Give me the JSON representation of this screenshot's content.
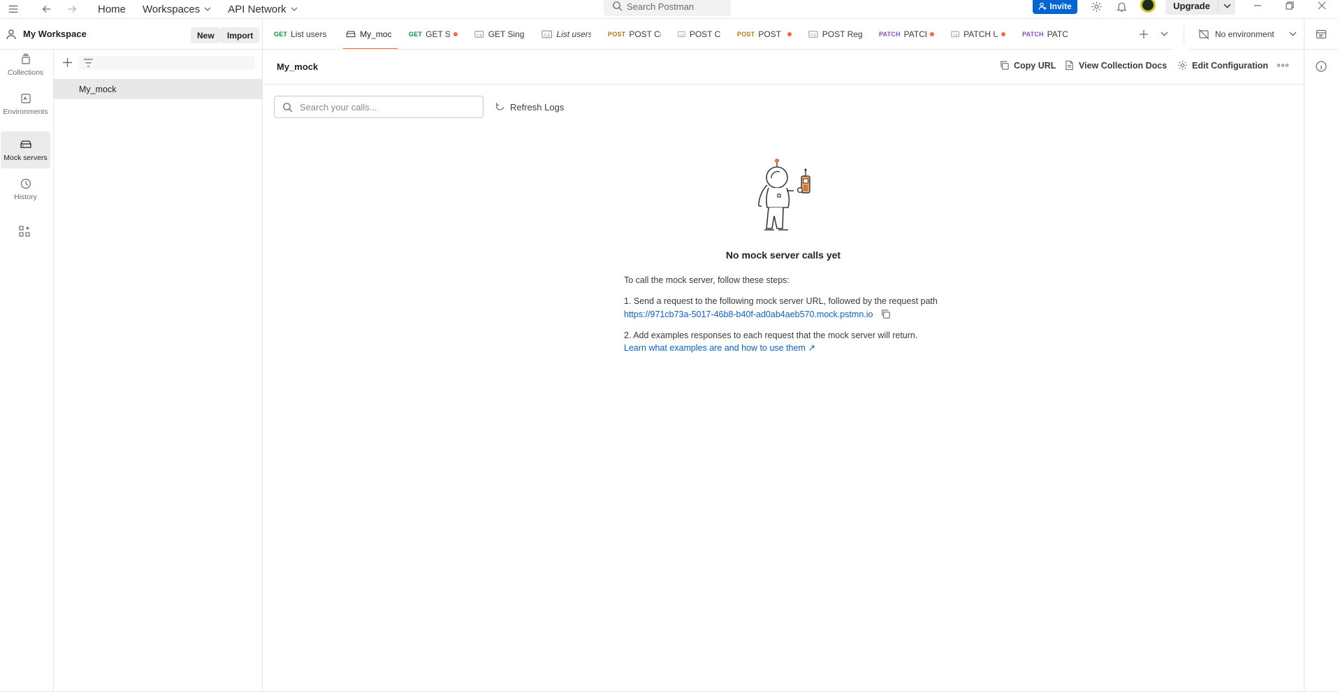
{
  "topbar": {
    "home": "Home",
    "workspaces": "Workspaces",
    "api_network": "API Network",
    "search_placeholder": "Search Postman",
    "invite": "Invite",
    "upgrade": "Upgrade"
  },
  "workspace": {
    "name": "My Workspace",
    "new_label": "New",
    "import_label": "Import"
  },
  "tabs": [
    {
      "method": "GET",
      "label": "List users",
      "dot": false,
      "italic": false,
      "active": false
    },
    {
      "method": "",
      "label": "My_mock",
      "dot": false,
      "italic": false,
      "active": true
    },
    {
      "method": "GET",
      "label": "GET Single",
      "dot": true,
      "italic": false,
      "active": false
    },
    {
      "method": "",
      "label": "GET Single",
      "dot": false,
      "italic": false,
      "active": false
    },
    {
      "method": "",
      "label": "List users",
      "dot": false,
      "italic": true,
      "active": false
    },
    {
      "method": "POST",
      "label": "POST Cre",
      "dot": false,
      "italic": false,
      "active": false
    },
    {
      "method": "",
      "label": "POST Creat",
      "dot": false,
      "italic": false,
      "active": false
    },
    {
      "method": "POST",
      "label": "POST Re",
      "dot": true,
      "italic": false,
      "active": false
    },
    {
      "method": "",
      "label": "POST Regis",
      "dot": false,
      "italic": false,
      "active": false
    },
    {
      "method": "PATCH",
      "label": "PATCH U",
      "dot": true,
      "italic": false,
      "active": false
    },
    {
      "method": "",
      "label": "PATCH Upd",
      "dot": true,
      "italic": false,
      "active": false
    },
    {
      "method": "PATCH",
      "label": "PATCH U",
      "dot": false,
      "italic": false,
      "active": false
    }
  ],
  "environment": {
    "label": "No environment"
  },
  "rail": {
    "collections": "Collections",
    "environments": "Environments",
    "mock_servers": "Mock servers",
    "history": "History"
  },
  "sidebar": {
    "items": [
      {
        "label": "My_mock"
      }
    ]
  },
  "main": {
    "title": "My_mock",
    "copy_url": "Copy URL",
    "view_docs": "View Collection Docs",
    "edit_config": "Edit Configuration",
    "search_placeholder": "Search your calls...",
    "refresh_logs": "Refresh Logs",
    "empty_title": "No mock server calls yet",
    "intro": "To call the mock server, follow these steps:",
    "step1": "1. Send a request to the following mock server URL, followed by the request path",
    "mock_url": "https://971cb73a-5017-46b8-b40f-ad0ab4aeb570.mock.pstmn.io",
    "step2": "2. Add examples responses to each request that the mock server will return.",
    "learn_link": "Learn what examples are and how to use them ↗"
  },
  "colors": {
    "accent": "#f26b3a",
    "primary_blue": "#0265d2",
    "link": "#0b62c9",
    "get": "#0d8a3a",
    "post": "#b07c12",
    "patch": "#8b4cc2"
  }
}
